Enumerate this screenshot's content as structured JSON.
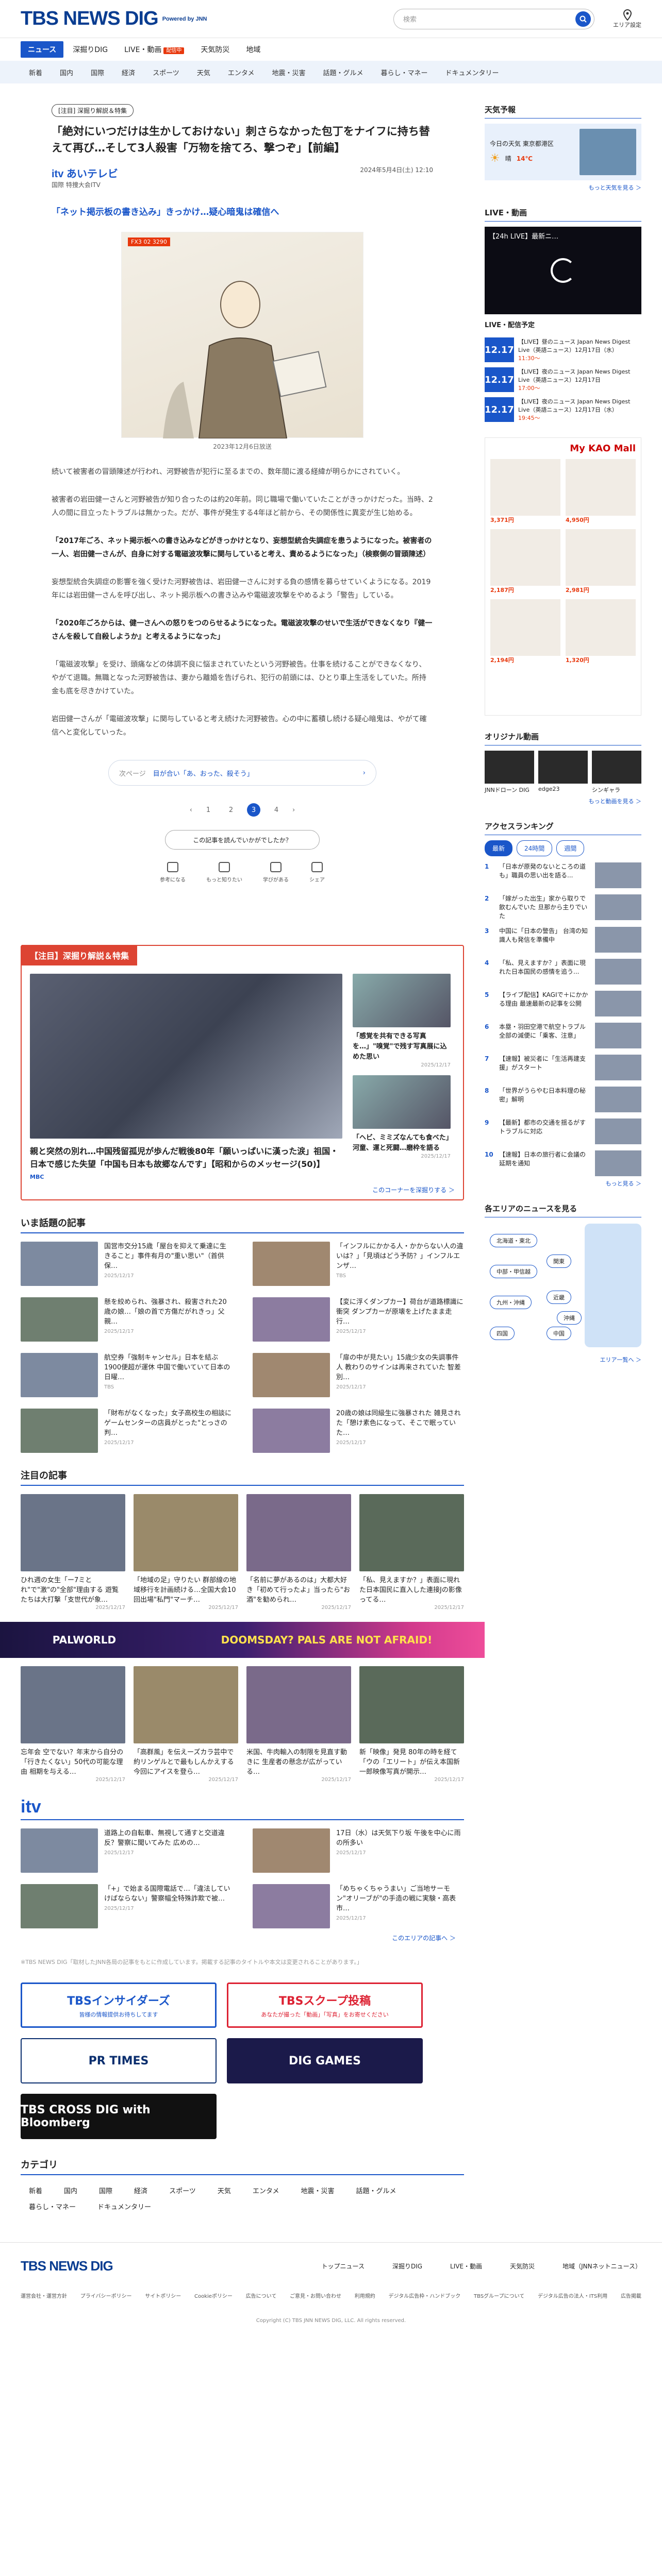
{
  "header": {
    "brand": "TBS NEWS DIG",
    "powered": "Powered by JNN",
    "search_placeholder": "検索",
    "area_label": "エリア設定"
  },
  "nav": {
    "tabs": [
      {
        "label": "ニュース"
      },
      {
        "label": "深掘りDIG"
      },
      {
        "label": "LIVE・動画",
        "badge": "配信中"
      },
      {
        "label": "天気防災"
      },
      {
        "label": "地域"
      }
    ],
    "categories": [
      "新着",
      "国内",
      "国際",
      "経済",
      "スポーツ",
      "天気",
      "エンタメ",
      "地震・災害",
      "話題・グルメ",
      "暮らし・マネー",
      "ドキュメンタリー"
    ]
  },
  "article": {
    "tag": "[注目] 深掘り解説＆特集",
    "title": "「絶対にいつだけは生かしておけない」刺さらなかった包丁をナイフに持ち替えて再び…そして3人殺害「万物を捨てろ、撃つぞ」【前編】",
    "source": "itv あいテレビ",
    "source_sub": "国際 特捜大会ITV",
    "date": "2024年5月4日(土) 12:10",
    "subtitle": "「ネット掲示板の書き込み」きっかけ…疑心暗鬼は確信へ",
    "image_label": "FX3 02 3290",
    "image_caption": "2023年12月6日放送",
    "paragraphs": [
      {
        "text": "続いて被害者の冒頭陳述が行われ、河野被告が犯行に至るまでの、数年間に渡る経緯が明らかにされていく。",
        "bold": false
      },
      {
        "text": "被害者の岩田健一さんと河野被告が知り合ったのは約20年前。同じ職場で働いていたことがきっかけだった。当時、2人の間に目立ったトラブルは無かった。だが、事件が発生する4年ほど前から、その関係性に異変が生じ始める。",
        "bold": false
      },
      {
        "text": "「2017年ごろ、ネット掲示板への書き込みなどがきっかけとなり、妄想型統合失調症を患うようになった。被害者の一人、岩田健一さんが、自身に対する電磁波攻撃に関与していると考え、責めるようになった」（検察側の冒頭陳述）",
        "bold": true
      },
      {
        "text": "妄想型統合失調症の影響を強く受けた河野被告は、岩田健一さんに対する負の感情を募らせていくようになる。2019年には岩田健一さんを呼び出し、ネット掲示板への書き込みや電磁波攻撃をやめるよう「警告」している。",
        "bold": false
      },
      {
        "text": "「2020年ごろからは、健一さんへの怒りをつのらせるようになった。電磁波攻撃のせいで生活ができなくなり『健一さんを殺して自殺しようか』と考えるようになった」",
        "bold": true
      },
      {
        "text": "「電磁波攻撃」を受け、頭痛などの体調不良に悩まされていたという河野被告。仕事を続けることができなくなり、やがて退職。無職となった河野被告は、妻から離婚を告げられ、犯行の前頭には、ひとり車上生活をしていた。所持金も底を尽きかけていた。",
        "bold": false
      },
      {
        "text": "岩田健一さんが「電磁波攻撃」に関与していると考え続けた河野被告。心の中に蓄積し続ける疑心暗鬼は、やがて確信へと変化していった。",
        "bold": false
      }
    ],
    "related_label": "次ページ",
    "related_title": "目が合い「あ、おった、殺そう」",
    "pages": [
      "1",
      "2",
      "3",
      "4"
    ],
    "current_page": "3",
    "read_label": "この記事を読んでいかがでしたか？",
    "reactions": [
      "参考になる",
      "もっと知りたい",
      "学びがある",
      "シェア"
    ]
  },
  "feature": {
    "heading": "【注目】深掘り解説＆特集",
    "main_title": "親と突然の別れ…中国残留孤児が歩んだ戦後80年「願いっぱいに漢った涙」祖国・日本で感じた失望「中国も日本も故郷なんです」【昭和からのメッセージ(50)】",
    "main_source": "MBC",
    "side": [
      {
        "title": "「感覚を共有できる写真を…」\"嗅覚\"で残す写真展に込めた思い",
        "time": "2025/12/17"
      },
      {
        "title": "「ヘビ、ミミズなんても食べた」河童、運と死闘…磨枠を語る",
        "time": "2025/12/17"
      }
    ],
    "more": "このコーナーを深掘りする ＞"
  },
  "topics": {
    "heading": "いま話題の記事",
    "items": [
      {
        "title": "国営市交分15歳「屋台を抑えて乗達に生きること」事件有月の\"重い思い\"（首供保…",
        "time": "2025/12/17"
      },
      {
        "title": "「インフルにかかる人・かからない人の違いは？」「見頃はどう予防？」インフルエンザ…",
        "time": "TBS"
      },
      {
        "title": "懸を絞められ、強暴され、殺害された20歳の娘…「娘の首で方傷だがれきっ」父親…",
        "time": "2025/12/17"
      },
      {
        "title": "【変に浮くダンプカー】荷台が道路標識に衝突 ダンプカーが原壊を上げたまま走行…",
        "time": "2025/12/17"
      },
      {
        "title": "航空券「強制キャンセル」日本を結ぶ1900便超が運休 中国で働いていて日本の日曜…",
        "time": "TBS"
      },
      {
        "title": "「扉の中が見たい」15歳少女の失調事件人 教わりのサインは再来されていた 智差別…",
        "time": "2025/12/17"
      },
      {
        "title": "「財布がなくなった」女子高校生の相談にゲームセンターの店員がとった\"とっさの判…",
        "time": "2025/12/17"
      },
      {
        "title": "20歳の娘は同級生に強暴された 雑見された「憩け素色になって、そこで眠っていた…",
        "time": "2025/12/17"
      }
    ]
  },
  "attention": {
    "heading": "注目の記事",
    "items": [
      {
        "title": "ひれ週の女生「ー7ミとれ\"で\"激\"の\"全部\"理由する 遊覧たちは大打撃「支世代が象…",
        "time": "2025/12/17"
      },
      {
        "title": "「地域の足」守りたい 群部線の地域移行を計画続ける…全国大会10回出場\"私門\"マーチ…",
        "time": "2025/12/17"
      },
      {
        "title": "「名前に夢があるのは」大都大好き「初めて行ったよ」当ったら\"お酒\"を勧められ…",
        "time": "2025/12/17"
      },
      {
        "title": "「私、見えますか？」表面に現れた日本国民に直入した連接Jの影像ってる…",
        "time": "2025/12/17"
      },
      {
        "title": "忘年会 空でない？年末から自分の「行きたくない」50代の可能な理由 相期を与える…",
        "time": "2025/12/17"
      },
      {
        "title": "「高群風」を伝えーズカラ芸中で約リンゲルとで最もしんかえする 今回にアイスを登ら…",
        "time": "2025/12/17"
      },
      {
        "title": "米国、牛肉輸入の制限を見直す動きに 生産者の懸念が広がっている…",
        "time": "2025/12/17"
      },
      {
        "title": "新「映像」発見 80年の時を経て「ウの「エリート」が伝え本国新一郎映像写真が開示…",
        "time": "2025/12/17"
      }
    ]
  },
  "ad_bar": {
    "left": "PALWORLD",
    "right": "DOOMSDAY? PALS ARE NOT AFRAID!"
  },
  "itv_section": {
    "heading": "itv",
    "items": [
      {
        "title": "道路上の自転車、無視して通すと交道違反？警察に聞いてみた 広めの…",
        "time": "2025/12/17"
      },
      {
        "title": "17日（水）は天気下り坂 午後を中心に雨の所多い",
        "time": "2025/12/17"
      },
      {
        "title": "「+」で始まる国際電話で…「違法していけばならない」警察幅全特殊詐欺で被…",
        "time": "2025/12/17"
      },
      {
        "title": "「めちゃくちゃうまい」ご当地サーモン\"オリーブが\"の手造の戦に実験・高表市…",
        "time": "2025/12/17"
      }
    ],
    "more": "このエリアの記事へ ＞"
  },
  "notes": "※TBS NEWS DIG「取材したJNN各局の記事をもとに作成しています。掲載する記事のタイトルや本文は変更されることがあります。」",
  "banners": [
    {
      "label": "TBSインサイダーズ",
      "sub": "皆様の情報提供お待ちしてます"
    },
    {
      "label": "TBSスクープ投稿",
      "sub": "あなたが撮った「動画」「写真」をお寄せください"
    },
    {
      "label": "PR TIMES",
      "sub": ""
    },
    {
      "label": "DIG GAMES",
      "sub": ""
    },
    {
      "label": "TBS CROSS DIG with Bloomberg",
      "sub": ""
    }
  ],
  "categories_section": {
    "heading": "カテゴリ",
    "items": [
      "新着",
      "国内",
      "国際",
      "経済",
      "スポーツ",
      "天気",
      "エンタメ",
      "地震・災害",
      "話題・グルメ",
      "暮らし・マネー",
      "ドキュメンタリー"
    ]
  },
  "sidebar": {
    "weather": {
      "heading": "天気予報",
      "label": "今日の天気 東京都港区",
      "desc": "晴",
      "temp": "14℃",
      "more": "もっと天気を見る ＞"
    },
    "live": {
      "heading": "LIVE・動画",
      "title": "【24h LIVE】最新ニ…",
      "schedule_heading": "LIVE・配信予定",
      "schedule": [
        {
          "date": "12.17",
          "title": "【LIVE】昼のニュース Japan News Digest Live（英語ニュース）12月17日（水）",
          "time": "11:30～"
        },
        {
          "date": "12.17",
          "title": "【LIVE】夜のニュース Japan News Digest Live（英語ニュース）12月17日",
          "time": "17:00～"
        },
        {
          "date": "12.17",
          "title": "【LIVE】夜のニュース Japan News Digest Live（英語ニュース）12月17日（水）",
          "time": "19:45～"
        }
      ]
    },
    "ad": {
      "brand": "My KAO Mall",
      "prices": [
        "3,371円",
        "4,950円",
        "2,187円",
        "2,981円",
        "2,194円",
        "1,320円"
      ]
    },
    "original": {
      "heading": "オリジナル動画",
      "items": [
        "JNNドローン DIG",
        "edge23",
        "シンギャラ"
      ],
      "more": "もっと動画を見る ＞"
    },
    "ranking": {
      "heading": "アクセスランキング",
      "tabs": [
        "最新",
        "24時間",
        "週間"
      ],
      "items": [
        {
          "rank": "1",
          "title": "「日本が原発のないところの道も」職員の思い出を語る..."
        },
        {
          "rank": "2",
          "title": "「嫁がった出生」家から取りで飲むんでいた 旦那から主りでいた"
        },
        {
          "rank": "3",
          "title": "中国に「日本の警告」 台湾の知識人も発信を準備中"
        },
        {
          "rank": "4",
          "title": "「私、見えますか？」表面に現れた日本国民の感情を追う..."
        },
        {
          "rank": "5",
          "title": "【ライブ配信】KAGIで＋にかかる理由 最速最新の記事を公開"
        },
        {
          "rank": "6",
          "title": "本塁・羽田空港で航空トラブル 全部の減便に「乗客、注意」"
        },
        {
          "rank": "7",
          "title": "【速報】被災者に「生活再建支援」がスタート"
        },
        {
          "rank": "8",
          "title": "「世界がうらやむ日本料理の秘密」解明"
        },
        {
          "rank": "9",
          "title": "【最新】都市の交通を揺るがすトラブルに対応"
        },
        {
          "rank": "10",
          "title": "【速報】日本の旅行者に会議の延期を通知"
        }
      ],
      "more": "もっと見る ＞"
    },
    "areas": {
      "heading": "各エリアのニュースを見る",
      "items": [
        "北海道・東北",
        "関東",
        "中部・甲信越",
        "近畿",
        "九州・沖縄",
        "四国",
        "中国",
        "沖縄"
      ],
      "more": "エリア一覧へ ＞"
    }
  },
  "footer": {
    "brand": "TBS NEWS DIG",
    "links": [
      "トップニュース",
      "深掘りDIG",
      "LIVE・動画",
      "天気防災",
      "地域（JNNネットニュース）"
    ],
    "sublinks": [
      "運営会社・運営方針",
      "プライバシーポリシー",
      "サイトポリシー",
      "Cookieポリシー",
      "広告について",
      "ご意見・お問い合わせ",
      "利用規約",
      "デジタル広告枠・ハンドブック",
      "TBSグループについて",
      "デジタル広告の法人・ITS利用",
      "広告掲載"
    ],
    "copyright": "Copyright (C) TBS JNN NEWS DIG, LLC. All rights reserved."
  }
}
